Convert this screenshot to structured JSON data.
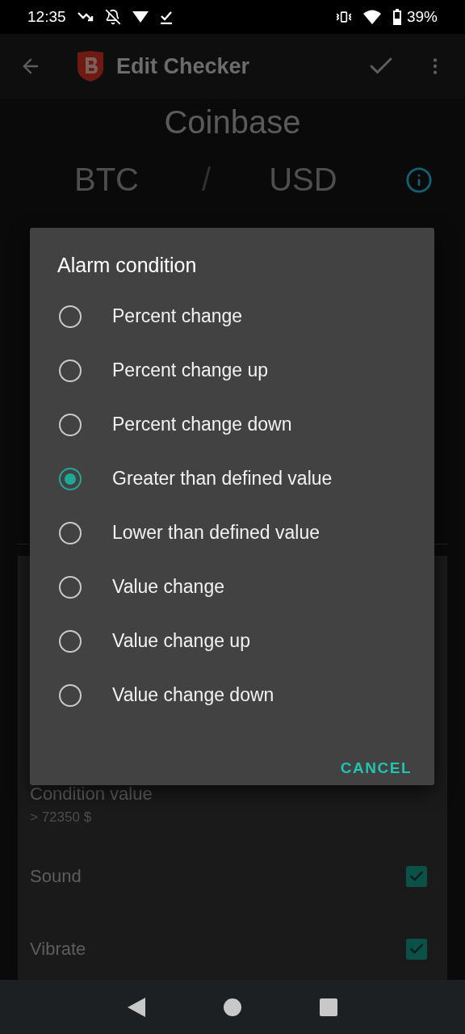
{
  "status_bar": {
    "time": "12:35",
    "battery": "39%"
  },
  "app_bar": {
    "title": "Edit Checker"
  },
  "exchange": "Coinbase",
  "pair": {
    "base": "BTC",
    "separator": "/",
    "quote": "USD"
  },
  "settings": [
    {
      "kind": "value",
      "label": "Condition value",
      "value": "> 72350 $"
    },
    {
      "kind": "checkbox",
      "label": "Sound",
      "checked": true
    },
    {
      "kind": "checkbox",
      "label": "Vibrate",
      "checked": true
    }
  ],
  "dialog": {
    "title": "Alarm condition",
    "options": [
      {
        "label": "Percent change",
        "selected": false
      },
      {
        "label": "Percent change up",
        "selected": false
      },
      {
        "label": "Percent change down",
        "selected": false
      },
      {
        "label": "Greater than defined value",
        "selected": true
      },
      {
        "label": "Lower than defined value",
        "selected": false
      },
      {
        "label": "Value change",
        "selected": false
      },
      {
        "label": "Value change up",
        "selected": false
      },
      {
        "label": "Value change down",
        "selected": false
      }
    ],
    "button": "CANCEL"
  }
}
